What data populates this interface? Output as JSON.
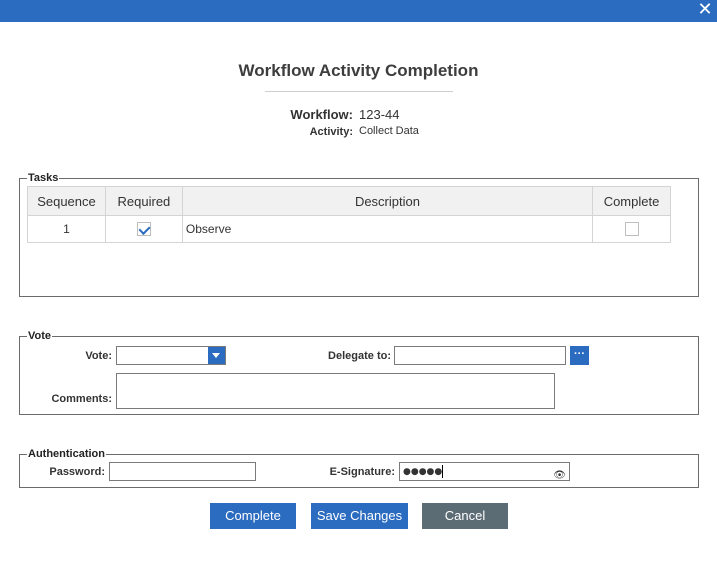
{
  "window": {
    "close_glyph": "✕"
  },
  "dialog": {
    "title": "Workflow Activity Completion",
    "workflow_label": "Workflow:",
    "workflow_value": "123-44",
    "activity_label": "Activity:",
    "activity_value": "Collect Data"
  },
  "tasks": {
    "legend": "Tasks",
    "columns": [
      "Sequence",
      "Required",
      "Description",
      "Complete"
    ],
    "rows": [
      {
        "sequence": "1",
        "required": true,
        "description": "Observe",
        "complete": false
      }
    ]
  },
  "vote": {
    "legend": "Vote",
    "vote_label": "Vote:",
    "vote_value": "",
    "delegate_label": "Delegate to:",
    "delegate_value": "",
    "comments_label": "Comments:",
    "comments_value": ""
  },
  "authentication": {
    "legend": "Authentication",
    "password_label": "Password:",
    "password_value": "",
    "esignature_label": "E-Signature:",
    "esignature_masked": "●●●●●"
  },
  "buttons": {
    "complete": "Complete",
    "save_changes": "Save Changes",
    "cancel": "Cancel"
  },
  "colors": {
    "accent": "#2b6cc0",
    "cancel_button": "#5c6c75"
  },
  "icons": {
    "close": "close-icon",
    "dropdown": "chevron-down-icon",
    "browse": "ellipsis-icon",
    "reveal": "eye-icon"
  }
}
